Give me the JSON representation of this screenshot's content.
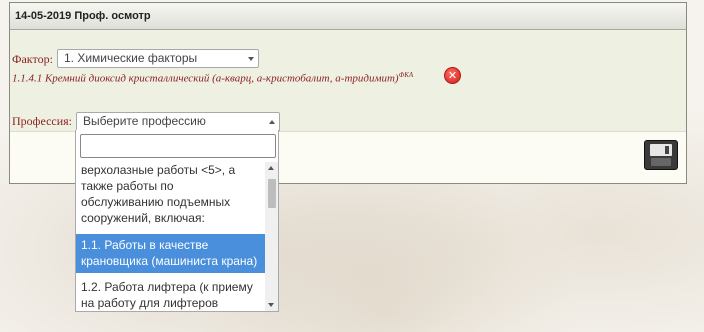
{
  "panel": {
    "title": "14-05-2019 Проф. осмотр"
  },
  "factor": {
    "label": "Фактор:",
    "selected": "1. Химические факторы"
  },
  "chosen_item": {
    "text": "1.1.4.1 Кремний диоксид кристаллический (а-кварц, а-кристобалит, а-тридимит)",
    "sup": "ФКА"
  },
  "profession": {
    "label": "Профессия:",
    "placeholder": "Выберите профессию"
  },
  "dropdown": {
    "search_value": "",
    "options": [
      {
        "label": "верхолазные работы <5>, а также работы по обслуживанию подъемных сооружений, включая:",
        "state": "group"
      },
      {
        "label": "1.1. Работы в качестве крановщика (машиниста крана)",
        "state": "selected"
      },
      {
        "label": "1.2. Работа лифтера (к приему на работу для лифтеров",
        "state": "normal"
      }
    ]
  },
  "icons": {
    "remove": "remove-icon",
    "save": "save-floppy-icon",
    "dropdown_caret": "chevron-down-icon"
  },
  "colors": {
    "label_red": "#8b2222",
    "selected_option_bg": "#4a8fdc"
  }
}
